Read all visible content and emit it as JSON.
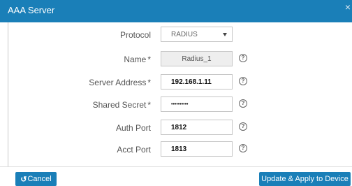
{
  "dialog": {
    "title": "AAA Server",
    "close_glyph": "×"
  },
  "form": {
    "protocol": {
      "label": "Protocol",
      "value": "RADIUS"
    },
    "name": {
      "label": "Name",
      "required_mark": "*",
      "value": "Radius_1"
    },
    "server_address": {
      "label": "Server Address",
      "required_mark": "*",
      "value": "192.168.1.11"
    },
    "shared_secret": {
      "label": "Shared Secret",
      "required_mark": "*",
      "value": "••••••••••"
    },
    "auth_port": {
      "label": "Auth Port",
      "value": "1812"
    },
    "acct_port": {
      "label": "Acct Port",
      "value": "1813"
    },
    "help_glyph": "?"
  },
  "footer": {
    "cancel_label": "Cancel",
    "cancel_icon_glyph": "↺",
    "apply_label": "Update & Apply to Device"
  },
  "colors": {
    "header_bg": "#1a7fb8",
    "button_bg": "#1a7fb8",
    "readonly_bg": "#eeeeee"
  },
  "icons": [
    "close-icon",
    "help-icon",
    "undo-icon",
    "dropdown-arrow-icon"
  ]
}
